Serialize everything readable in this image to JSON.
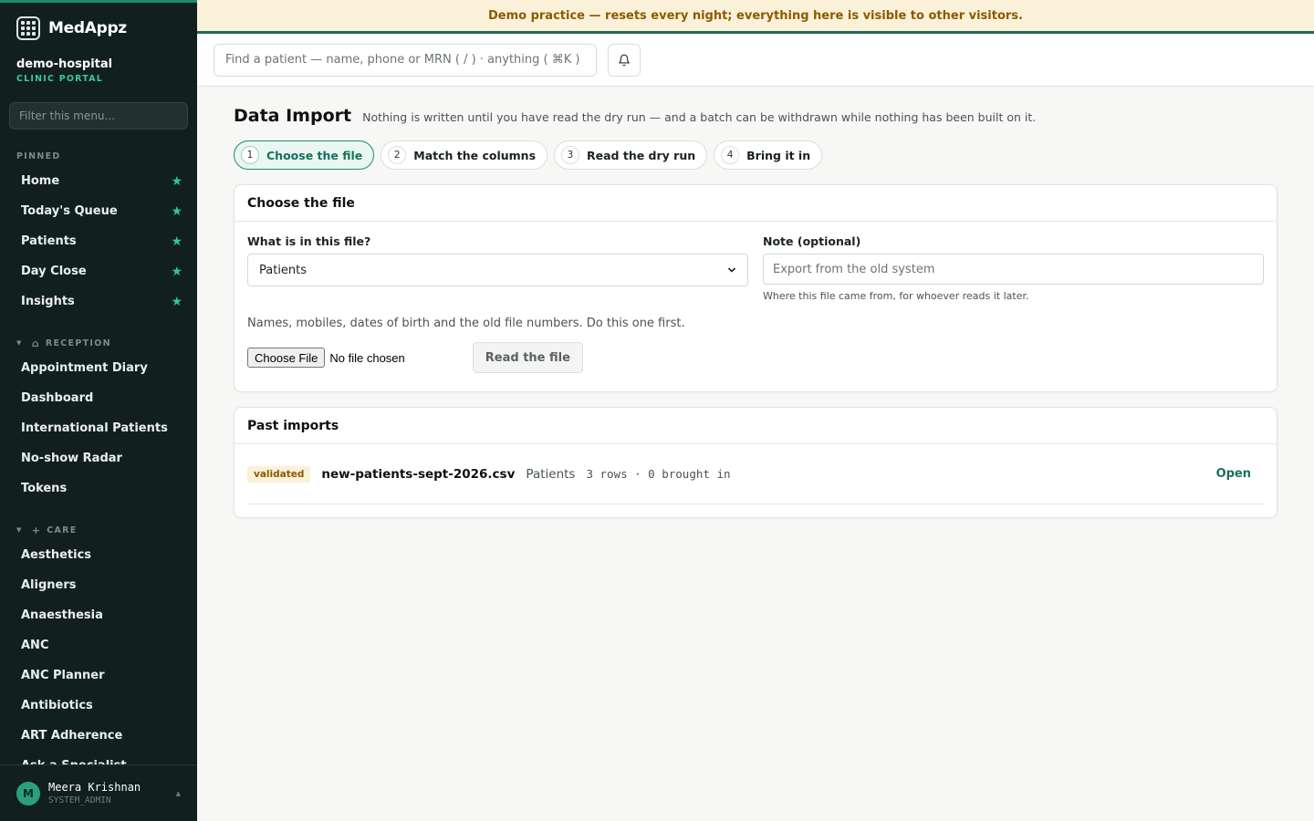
{
  "app": {
    "name": "MedAppz"
  },
  "org": {
    "name": "demo-hospital",
    "subtitle": "CLINIC PORTAL"
  },
  "sidebar": {
    "filter_placeholder": "Filter this menu...",
    "pinned_label": "PINNED",
    "pinned": [
      {
        "label": "Home"
      },
      {
        "label": "Today's Queue"
      },
      {
        "label": "Patients"
      },
      {
        "label": "Day Close"
      },
      {
        "label": "Insights"
      }
    ],
    "reception_label": "RECEPTION",
    "reception": [
      {
        "label": "Appointment Diary"
      },
      {
        "label": "Dashboard"
      },
      {
        "label": "International Patients"
      },
      {
        "label": "No-show Radar"
      },
      {
        "label": "Tokens"
      }
    ],
    "care_label": "CARE",
    "care": [
      {
        "label": "Aesthetics"
      },
      {
        "label": "Aligners"
      },
      {
        "label": "Anaesthesia"
      },
      {
        "label": "ANC"
      },
      {
        "label": "ANC Planner"
      },
      {
        "label": "Antibiotics"
      },
      {
        "label": "ART Adherence"
      },
      {
        "label": "Ask a Specialist"
      }
    ]
  },
  "user": {
    "initial": "M",
    "name": "Meera Krishnan",
    "role": "SYSTEM_ADMIN"
  },
  "banner": {
    "text": "Demo practice — resets every night; everything here is visible to other visitors."
  },
  "topbar": {
    "search_placeholder": "Find a patient — name, phone or MRN ( / ) · anything ( ⌘K )"
  },
  "page": {
    "title": "Data Import",
    "subtitle": "Nothing is written until you have read the dry run — and a batch can be withdrawn while nothing has been built on it."
  },
  "steps": [
    {
      "num": "1",
      "label": "Choose the file"
    },
    {
      "num": "2",
      "label": "Match the columns"
    },
    {
      "num": "3",
      "label": "Read the dry run"
    },
    {
      "num": "4",
      "label": "Bring it in"
    }
  ],
  "choose": {
    "title": "Choose the file",
    "type_label": "What is in this file?",
    "type_value": "Patients",
    "note_label": "Note (optional)",
    "note_placeholder": "Export from the old system",
    "note_hint": "Where this file came from, for whoever reads it later.",
    "description": "Names, mobiles, dates of birth and the old file numbers. Do this one first.",
    "file_button": "Choose File",
    "file_status": "No file chosen",
    "read_button": "Read the file"
  },
  "past": {
    "title": "Past imports",
    "rows": [
      {
        "status": "validated",
        "file": "new-patients-sept-2026.csv",
        "kind": "Patients",
        "stats": "3 rows · 0 brought in",
        "action": "Open"
      }
    ]
  }
}
